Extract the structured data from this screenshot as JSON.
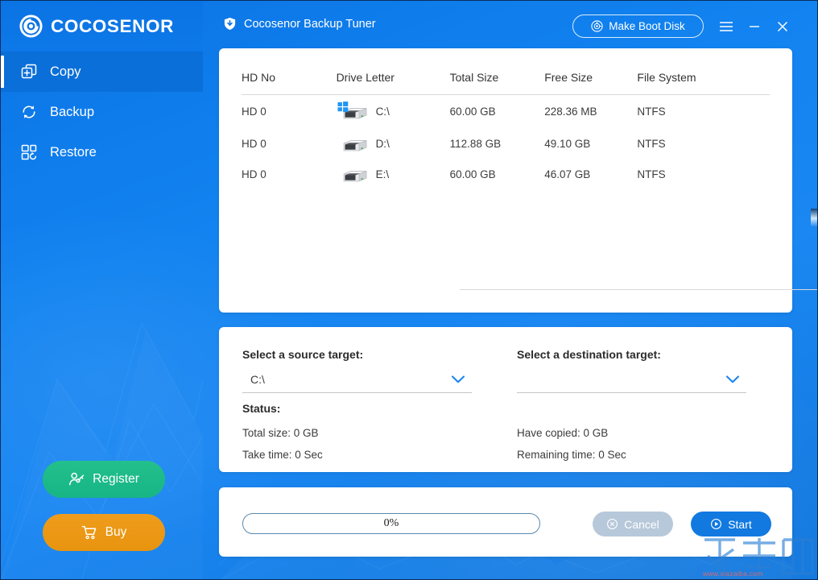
{
  "brand": {
    "name": "COCOSENOR",
    "logo_icon": "cocosenor-logo-icon"
  },
  "titlebar": {
    "app_title": "Cocosenor Backup Tuner",
    "app_title_icon": "shield-download-icon",
    "boot_disk_label": "Make Boot Disk",
    "boot_disk_icon": "disc-icon",
    "menu_icon": "hamburger-menu-icon",
    "minimize_icon": "minimize-icon",
    "close_icon": "close-icon"
  },
  "sidebar": {
    "items": [
      {
        "label": "Copy",
        "icon": "copy-plus-icon",
        "active": true
      },
      {
        "label": "Backup",
        "icon": "refresh-cycle-icon",
        "active": false
      },
      {
        "label": "Restore",
        "icon": "restore-grid-icon",
        "active": false
      }
    ],
    "register_label": "Register",
    "register_icon": "user-key-icon",
    "buy_label": "Buy",
    "buy_icon": "shopping-cart-icon"
  },
  "drives_table": {
    "columns": [
      "HD No",
      "Drive Letter",
      "Total Size",
      "Free Size",
      "File System"
    ],
    "rows": [
      {
        "hd_no": "HD 0",
        "drive_letter": "C:\\",
        "total_size": "60.00 GB",
        "free_size": "228.36 MB",
        "file_system": "NTFS",
        "icon": "hard-drive-windows-icon"
      },
      {
        "hd_no": "HD 0",
        "drive_letter": "D:\\",
        "total_size": "112.88 GB",
        "free_size": "49.10 GB",
        "file_system": "NTFS",
        "icon": "hard-drive-icon"
      },
      {
        "hd_no": "HD 0",
        "drive_letter": "E:\\",
        "total_size": "60.00 GB",
        "free_size": "46.07 GB",
        "file_system": "NTFS",
        "icon": "hard-drive-icon"
      }
    ]
  },
  "select_panel": {
    "source_label": "Select a source target:",
    "source_value": "C:\\",
    "destination_label": "Select a destination target:",
    "destination_value": "",
    "caret_icon": "chevron-down-icon",
    "status_label": "Status:",
    "total_size_line": "Total size:  0 GB",
    "take_time_line": "Take time:  0 Sec",
    "have_copied_line": "Have  copied:  0 GB",
    "remaining_time_line": "Remaining time:  0 Sec"
  },
  "action_panel": {
    "progress_text": "0%",
    "progress_percent": 0,
    "cancel_label": "Cancel",
    "cancel_icon": "cancel-circle-icon",
    "start_label": "Start",
    "start_icon": "play-circle-icon"
  },
  "watermark": {
    "text": "下载吧",
    "url": "www.xiazaiba.com"
  },
  "colors": {
    "brand_blue": "#0b74e5",
    "sidebar_active": "#0a6fd8",
    "register_green": "#19b888",
    "buy_orange": "#ea960f",
    "start_blue": "#1179e0",
    "cancel_grey": "#b7c8da"
  }
}
